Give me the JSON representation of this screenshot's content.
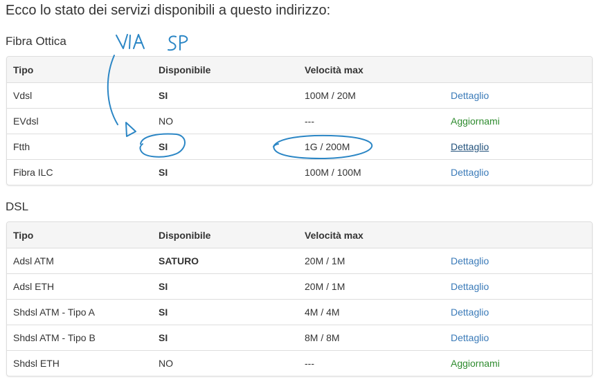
{
  "heading": "Ecco lo stato dei servizi disponibili a questo indirizzo:",
  "columns": {
    "tipo": "Tipo",
    "disponibile": "Disponibile",
    "velocita": "Velocità max"
  },
  "fibra": {
    "title": "Fibra Ottica",
    "rows": [
      {
        "tipo": "Vdsl",
        "disponibile": "SI",
        "velocita": "100M / 20M",
        "action": "Dettaglio"
      },
      {
        "tipo": "EVdsl",
        "disponibile": "NO",
        "velocita": "---",
        "action": "Aggiornami"
      },
      {
        "tipo": "Ftth",
        "disponibile": "SI",
        "velocita": "1G / 200M",
        "action": "Dettaglio"
      },
      {
        "tipo": "Fibra ILC",
        "disponibile": "SI",
        "velocita": "100M / 100M",
        "action": "Dettaglio"
      }
    ]
  },
  "dsl": {
    "title": "DSL",
    "rows": [
      {
        "tipo": "Adsl ATM",
        "disponibile": "SATURO",
        "velocita": "20M / 1M",
        "action": "Dettaglio"
      },
      {
        "tipo": "Adsl ETH",
        "disponibile": "SI",
        "velocita": "20M / 1M",
        "action": "Dettaglio"
      },
      {
        "tipo": "Shdsl ATM - Tipo A",
        "disponibile": "SI",
        "velocita": "4M / 4M",
        "action": "Dettaglio"
      },
      {
        "tipo": "Shdsl ATM - Tipo B",
        "disponibile": "SI",
        "velocita": "8M / 8M",
        "action": "Dettaglio"
      },
      {
        "tipo": "Shdsl ETH",
        "disponibile": "NO",
        "velocita": "---",
        "action": "Aggiornami"
      }
    ]
  },
  "annotation": {
    "text": "VIA SP",
    "color": "#2b86c5"
  }
}
